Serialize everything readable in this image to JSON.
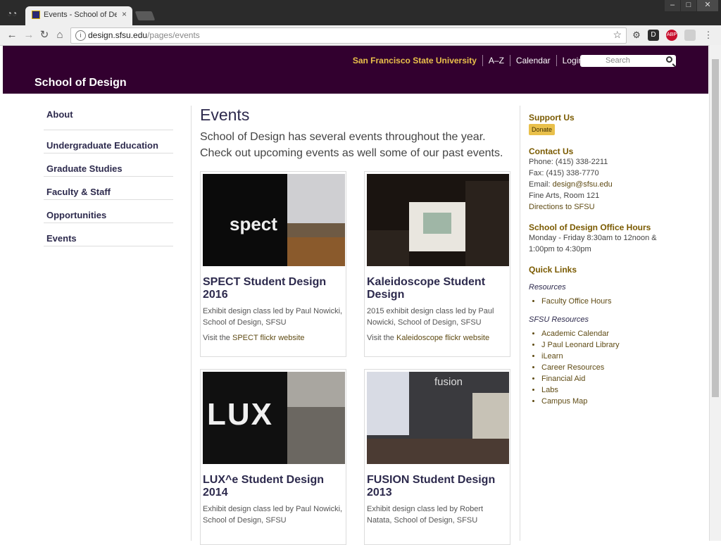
{
  "browser": {
    "tab_title": "Events - School of Design",
    "tab_close": "×",
    "url_domain": "design.sfsu.edu",
    "url_path": "/pages/events"
  },
  "header": {
    "university": "San Francisco State University",
    "links": [
      "A–Z",
      "Calendar",
      "Login"
    ],
    "search_placeholder": "Search",
    "site_title": "School of Design"
  },
  "nav": [
    "About",
    "Undergraduate Education",
    "Graduate Studies",
    "Faculty & Staff",
    "Opportunities",
    "Events"
  ],
  "main": {
    "title": "Events",
    "intro": "School of Design has several events throughout the year. Check out upcoming events as well some of our past events.",
    "cards": [
      {
        "title": "SPECT Student Design 2016",
        "desc": "Exhibit design class led by Paul Nowicki, School of Design, SFSU",
        "visit_prefix": "Visit the ",
        "visit_link": "SPECT flickr website",
        "img_text": "spect"
      },
      {
        "title": "Kaleidoscope Student Design",
        "desc": "2015 exhibit design class led by Paul Nowicki, School of Design, SFSU",
        "visit_prefix": "Visit the ",
        "visit_link": "Kaleidoscope flickr website",
        "img_text": ""
      },
      {
        "title": "LUX^e Student Design 2014",
        "desc": "Exhibit design class led by Paul Nowicki, School of Design, SFSU",
        "visit_prefix": "",
        "visit_link": "",
        "img_text": "LUX"
      },
      {
        "title": "FUSION Student Design 2013",
        "desc": "Exhibit design class led by Robert Natata, School of Design, SFSU",
        "visit_prefix": "",
        "visit_link": "",
        "img_text": "fusion"
      }
    ]
  },
  "sidebar": {
    "support_title": "Support Us",
    "donate": "Donate",
    "contact_title": "Contact Us",
    "phone": "Phone: (415) 338-2211",
    "fax": "Fax: (415) 338-7770",
    "email_prefix": "Email: ",
    "email": "design@sfsu.edu",
    "room": "Fine Arts, Room 121",
    "directions": "Directions to SFSU",
    "hours_title": "School of Design Office Hours",
    "hours": "Monday - Friday 8:30am to 12noon & 1:00pm to 4:30pm",
    "quick_title": "Quick Links",
    "resources_title": "Resources",
    "resources": [
      "Faculty Office Hours"
    ],
    "sfsu_title": "SFSU Resources",
    "sfsu_resources": [
      "Academic Calendar",
      "J Paul Leonard Library",
      "iLearn",
      "Career Resources",
      "Financial Aid",
      "Labs",
      "Campus Map"
    ]
  }
}
